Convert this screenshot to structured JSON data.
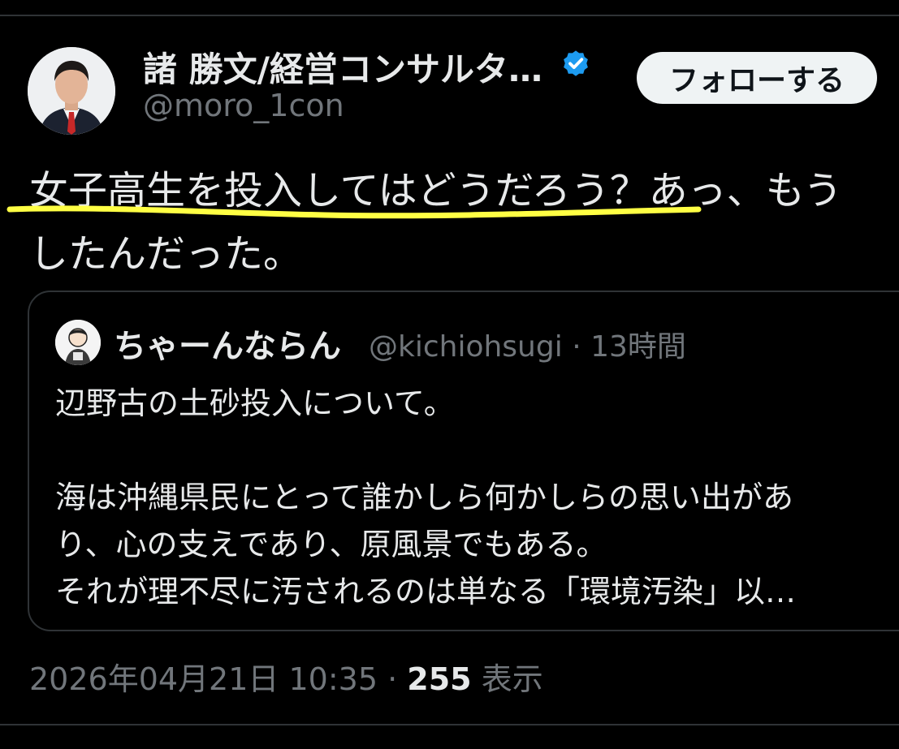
{
  "tweet": {
    "author": {
      "display_name": "諸 勝文/経営コンサルタ…",
      "handle": "@moro_1con",
      "verified": true
    },
    "follow_button_label": "フォローする",
    "text_lines": [
      "女子高生を投入してはどうだろう？あっ、もう",
      "したんだった。"
    ],
    "highlight": {
      "color": "#ffff44"
    },
    "quoted": {
      "display_name": "ちゃーんならん",
      "handle": "@kichiohsugi",
      "separator": "·",
      "time_ago": "13時間",
      "text_lines": [
        "辺野古の土砂投入について。",
        "",
        "海は沖縄県民にとって誰かしら何かしらの思い出があ",
        "り、心の支えであり、原風景でもある。",
        "それが理不尽に汚されるのは単なる「環境汚染」以…"
      ]
    },
    "timestamp": "2026年04月21日 10:35",
    "meta_separator": "·",
    "views_count": "255",
    "views_label": "表示"
  },
  "colors": {
    "background": "#000000",
    "text_primary": "#e7e9ea",
    "text_secondary": "#71767b",
    "border": "#2f3336",
    "verified_blue": "#1d9bf0",
    "follow_bg": "#eff3f4"
  }
}
